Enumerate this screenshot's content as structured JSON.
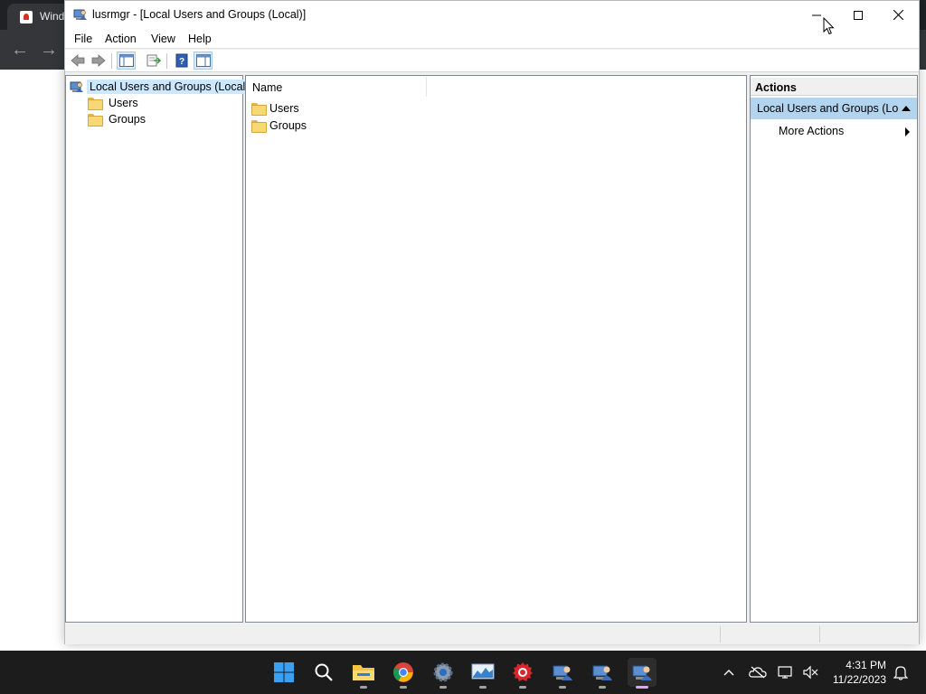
{
  "background_browser": {
    "tab_title": "Wind"
  },
  "window": {
    "title": "lusrmgr - [Local Users and Groups (Local)]"
  },
  "menu": {
    "file": "File",
    "action": "Action",
    "view": "View",
    "help": "Help"
  },
  "toolbar": {
    "icons": [
      "back-icon",
      "forward-icon",
      "show-hide-console-tree-icon",
      "export-list-icon",
      "help-icon",
      "show-hide-action-pane-icon"
    ]
  },
  "tree": {
    "root": "Local Users and Groups (Local)",
    "children": [
      "Users",
      "Groups"
    ]
  },
  "list": {
    "column_name": "Name",
    "rows": [
      "Users",
      "Groups"
    ]
  },
  "actions": {
    "header": "Actions",
    "section": "Local Users and Groups (Lo...",
    "more_actions": "More Actions"
  },
  "taskbar": {
    "time": "4:31 PM",
    "date": "11/22/2023",
    "apps": [
      "start-icon",
      "search-icon",
      "file-explorer-icon",
      "chrome-icon",
      "settings-icon",
      "monitor-app-icon",
      "redcircle-app-icon",
      "mmc-app-icon",
      "mmc-app-icon",
      "mmc-app-icon"
    ]
  },
  "colors": {
    "selection": "#cce8ff",
    "actions_section": "#b3d4ee",
    "taskbar": "#1c1c1c"
  }
}
